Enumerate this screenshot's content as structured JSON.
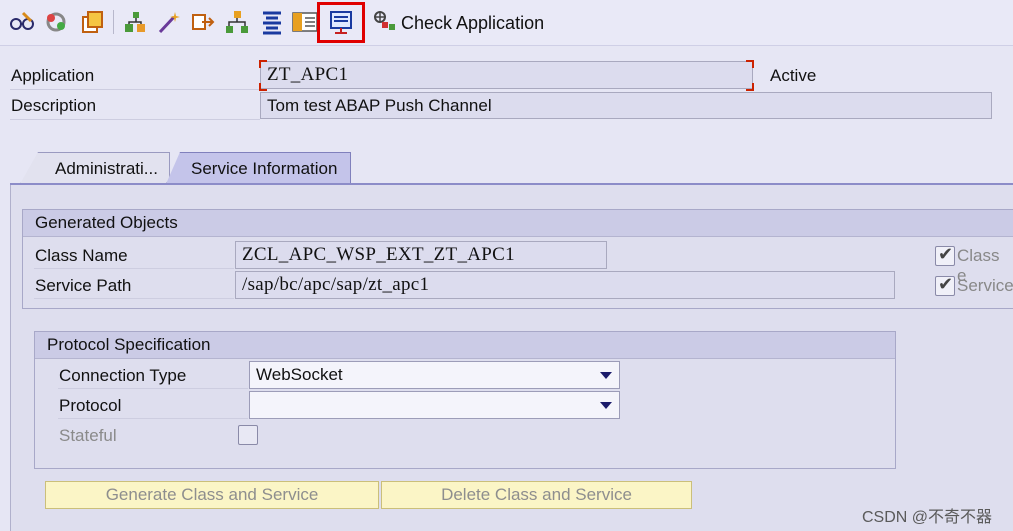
{
  "toolbar": {
    "icons": [
      "glasses-icon",
      "refresh-icon",
      "copy-icon",
      "hierarchy-icon",
      "magic-wand-icon",
      "export-icon",
      "tree-icon",
      "align-icon",
      "table-icon",
      "highlighted-tool-icon"
    ],
    "check_label": "Check Application"
  },
  "header": {
    "application_label": "Application",
    "application_value": "ZT_APC1",
    "status": "Active",
    "description_label": "Description",
    "description_value": "Tom test ABAP Push Channel"
  },
  "tabs": [
    {
      "label": "Administrati..."
    },
    {
      "label": "Service Information"
    }
  ],
  "generated_objects": {
    "title": "Generated Objects",
    "class_name_label": "Class Name",
    "class_name_value": "ZCL_APC_WSP_EXT_ZT_APC1",
    "service_path_label": "Service Path",
    "service_path_value": "/sap/bc/apc/sap/zt_apc1",
    "class_exists_label": "Class e",
    "service_exists_label": "Service"
  },
  "protocol": {
    "title": "Protocol Specification",
    "connection_type_label": "Connection Type",
    "connection_type_value": "WebSocket",
    "protocol_label": "Protocol",
    "protocol_value": "",
    "stateful_label": "Stateful"
  },
  "buttons": {
    "generate": "Generate Class and Service",
    "delete": "Delete Class and Service"
  },
  "watermark": "CSDN @不奇不器",
  "colors": {
    "highlight": "#e00000",
    "tab_active": "#c4c4ea",
    "button_bg": "#fbf5c6"
  }
}
